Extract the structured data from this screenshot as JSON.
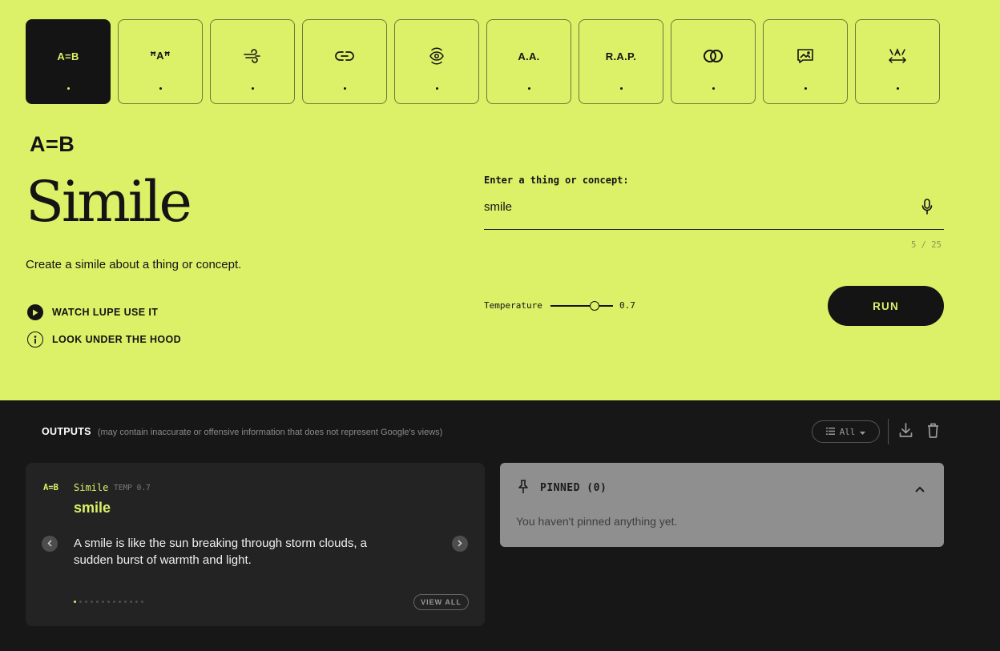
{
  "tools": [
    {
      "glyph": "A=B",
      "active": true
    },
    {
      "glyph": "ꟸAꟸ",
      "active": false
    },
    {
      "glyph": "",
      "icon": "wind-icon",
      "active": false
    },
    {
      "glyph": "",
      "icon": "link-icon",
      "active": false
    },
    {
      "glyph": "",
      "icon": "eye-rotate-icon",
      "active": false
    },
    {
      "glyph": "A.A.",
      "active": false
    },
    {
      "glyph": "R.A.P.",
      "active": false
    },
    {
      "glyph": "",
      "icon": "venn-icon",
      "active": false
    },
    {
      "glyph": "",
      "icon": "image-icon",
      "active": false
    },
    {
      "glyph": "",
      "icon": "stretch-icon",
      "active": false
    }
  ],
  "app": {
    "abbr": "A=B",
    "title": "Simile",
    "description": "Create a simile about a thing or concept.",
    "watch_label": "WATCH LUPE USE IT",
    "hood_label": "LOOK UNDER THE HOOD"
  },
  "input": {
    "label": "Enter a thing or concept:",
    "value": "smile",
    "counter": "5 / 25"
  },
  "temperature": {
    "label": "Temperature",
    "value": 0.7,
    "display": "0.7"
  },
  "run_label": "RUN",
  "outputs": {
    "title": "OUTPUTS",
    "note": "(may contain inaccurate or offensive information that does not represent Google's views)",
    "filter_label": "All",
    "card": {
      "abbr": "A=B",
      "name": "Simile",
      "temp": "TEMP 0.7",
      "input": "smile",
      "result": "A smile is like the sun breaking through storm clouds, a sudden burst of warmth and light.",
      "page_count": 13,
      "current_page": 1,
      "view_all": "VIEW ALL"
    },
    "pinned": {
      "title": "PINNED (0)",
      "empty": "You haven't pinned anything yet."
    }
  },
  "colors": {
    "accent": "#dcf068",
    "dark": "#141414",
    "panel": "#232323",
    "pinned_bg": "#8f8f8f"
  }
}
